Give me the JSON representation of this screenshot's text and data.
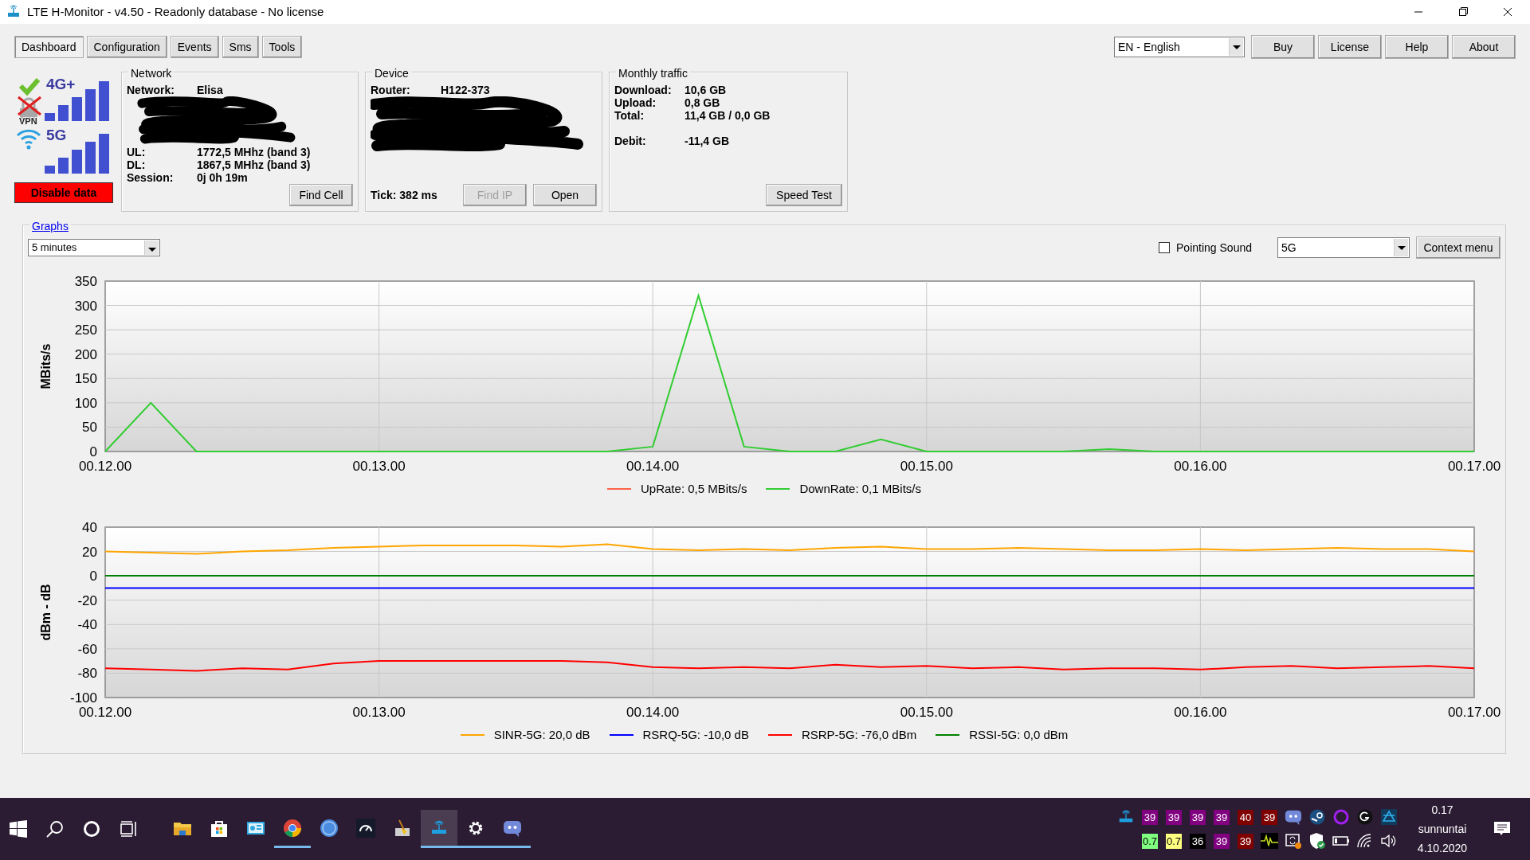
{
  "window": {
    "title": "LTE H-Monitor - v4.50 - Readonly database - No license"
  },
  "tabs": [
    {
      "label": "Dashboard",
      "selected": true
    },
    {
      "label": "Configuration",
      "selected": false
    },
    {
      "label": "Events",
      "selected": false
    },
    {
      "label": "Sms",
      "selected": false
    },
    {
      "label": "Tools",
      "selected": false
    }
  ],
  "language": {
    "value": "EN - English"
  },
  "top_buttons": [
    "Buy",
    "License",
    "Help",
    "About"
  ],
  "status": {
    "lte_label": "4G+",
    "nr_label": "5G",
    "vpn_label": "VPN",
    "disable_button": "Disable data"
  },
  "network": {
    "title": "Network",
    "rows_top": [
      {
        "label": "Network:",
        "value": "Elisa"
      }
    ],
    "rows_bottom": [
      {
        "label": "UL:",
        "value": "1772,5 MHhz (band 3)"
      },
      {
        "label": "DL:",
        "value": "1867,5 MHhz (band 3)"
      },
      {
        "label": "Session:",
        "value": "0j 0h 19m"
      }
    ],
    "button": "Find Cell"
  },
  "device": {
    "title": "Device",
    "rows_top": [
      {
        "label": "Router:",
        "value": "H122-373"
      }
    ],
    "tick": "Tick: 382 ms",
    "buttons": [
      {
        "label": "Find IP",
        "disabled": true
      },
      {
        "label": "Open",
        "disabled": false
      }
    ]
  },
  "traffic": {
    "title": "Monthly traffic",
    "rows": [
      {
        "label": "Download:",
        "value": "10,6 GB"
      },
      {
        "label": "Upload:",
        "value": "0,8 GB"
      },
      {
        "label": "Total:",
        "value": "11,4 GB / 0,0 GB"
      },
      {
        "label": "Debit:",
        "value": "-11,4 GB"
      }
    ],
    "button": "Speed Test"
  },
  "graphs": {
    "title": "Graphs",
    "period": "5 minutes",
    "pointing_sound": {
      "label": "Pointing Sound",
      "checked": false
    },
    "band": "5G",
    "context_button": "Context menu",
    "charts": [
      {
        "chart_data": {
          "type": "line",
          "grid": true,
          "ylabel": "MBits/s",
          "categories": [
            "00.12.00",
            null,
            null,
            null,
            null,
            null,
            "00.13.00",
            null,
            null,
            null,
            null,
            null,
            "00.14.00",
            null,
            null,
            null,
            null,
            null,
            "00.15.00",
            null,
            null,
            null,
            null,
            null,
            "00.16.00",
            null,
            null,
            null,
            null,
            null,
            "00.17.00"
          ],
          "ylim": [
            0,
            350
          ],
          "yticks": [
            0,
            50,
            100,
            150,
            200,
            250,
            300,
            350
          ],
          "series": [
            {
              "name": "UpRate: 0,5 MBits/s",
              "color": "#ff6347",
              "values": [
                null,
                null,
                null,
                null,
                null,
                null,
                null,
                null,
                null,
                null,
                null,
                null,
                null,
                null,
                null,
                null,
                null,
                null,
                null,
                null,
                null,
                null,
                null,
                null,
                null,
                null,
                null,
                null,
                null,
                null,
                null
              ]
            },
            {
              "name": "DownRate: 0,1 MBits/s",
              "color": "#32cd32",
              "values": [
                0,
                100,
                0,
                0,
                0,
                0,
                0,
                0,
                0,
                0,
                0,
                0,
                10,
                320,
                10,
                0,
                0,
                25,
                0,
                0,
                0,
                0,
                5,
                0,
                0,
                0,
                0,
                0,
                0,
                0,
                0
              ]
            }
          ]
        }
      },
      {
        "chart_data": {
          "type": "line",
          "grid": true,
          "ylabel": "dBm - dB",
          "categories": [
            "00.12.00",
            null,
            null,
            null,
            null,
            null,
            "00.13.00",
            null,
            null,
            null,
            null,
            null,
            "00.14.00",
            null,
            null,
            null,
            null,
            null,
            "00.15.00",
            null,
            null,
            null,
            null,
            null,
            "00.16.00",
            null,
            null,
            null,
            null,
            null,
            "00.17.00"
          ],
          "ylim": [
            -100,
            40
          ],
          "yticks": [
            -100,
            -80,
            -60,
            -40,
            -20,
            0,
            20,
            40
          ],
          "series": [
            {
              "name": "SINR-5G: 20,0 dB",
              "color": "#ffa500",
              "values": [
                20,
                19,
                18,
                20,
                21,
                23,
                24,
                25,
                25,
                25,
                24,
                26,
                22,
                21,
                22,
                21,
                23,
                24,
                22,
                22,
                23,
                22,
                21,
                21,
                22,
                21,
                22,
                23,
                22,
                22,
                20
              ]
            },
            {
              "name": "RSRQ-5G: -10,0 dB",
              "color": "#0000ff",
              "values": [
                -10,
                -10,
                -10,
                -10,
                -10,
                -10,
                -10,
                -10,
                -10,
                -10,
                -10,
                -10,
                -10,
                -10,
                -10,
                -10,
                -10,
                -10,
                -10,
                -10,
                -10,
                -10,
                -10,
                -10,
                -10,
                -10,
                -10,
                -10,
                -10,
                -10,
                -10
              ]
            },
            {
              "name": "RSRP-5G: -76,0 dBm",
              "color": "#ff0000",
              "values": [
                -76,
                -77,
                -78,
                -76,
                -77,
                -72,
                -70,
                -70,
                -70,
                -70,
                -70,
                -71,
                -75,
                -76,
                -75,
                -76,
                -73,
                -75,
                -74,
                -76,
                -75,
                -77,
                -76,
                -76,
                -77,
                -75,
                -74,
                -76,
                -75,
                -74,
                -76
              ]
            },
            {
              "name": "RSSI-5G: 0,0 dBm",
              "color": "#008000",
              "values": [
                0,
                0,
                0,
                0,
                0,
                0,
                0,
                0,
                0,
                0,
                0,
                0,
                0,
                0,
                0,
                0,
                0,
                0,
                0,
                0,
                0,
                0,
                0,
                0,
                0,
                0,
                0,
                0,
                0,
                0,
                0
              ]
            }
          ]
        }
      }
    ]
  },
  "taskbar": {
    "apps": [
      {
        "kind": "folder",
        "running": false,
        "selected": false
      },
      {
        "kind": "store",
        "running": false,
        "selected": false
      },
      {
        "kind": "dashboard",
        "running": false,
        "selected": false
      },
      {
        "kind": "browser",
        "running": true,
        "selected": false
      },
      {
        "kind": "torrent",
        "running": false,
        "selected": false
      },
      {
        "kind": "gauge",
        "running": false,
        "selected": false
      },
      {
        "kind": "cleaner",
        "running": false,
        "selected": false
      },
      {
        "kind": "router",
        "running": true,
        "selected": true
      },
      {
        "kind": "gear",
        "running": true,
        "selected": false
      },
      {
        "kind": "chat",
        "running": true,
        "selected": false
      }
    ],
    "tray_row1": [
      {
        "kind": "router"
      },
      {
        "kind": "badge",
        "text": "39",
        "color": "#800080"
      },
      {
        "kind": "badge",
        "text": "39",
        "color": "#800080"
      },
      {
        "kind": "badge",
        "text": "39",
        "color": "#800080"
      },
      {
        "kind": "badge",
        "text": "39",
        "color": "#800080"
      },
      {
        "kind": "badge",
        "text": "40",
        "color": "#800000"
      },
      {
        "kind": "badge",
        "text": "39",
        "color": "#800000"
      },
      {
        "kind": "chat"
      },
      {
        "kind": "steam"
      },
      {
        "kind": "ring"
      },
      {
        "kind": "logo"
      },
      {
        "kind": "app"
      }
    ],
    "tray_row2": [
      {
        "kind": "badge",
        "text": "0.7",
        "color": "#80ff80"
      },
      {
        "kind": "badge",
        "text": "0.7",
        "color": "#ffff80"
      },
      {
        "kind": "badge",
        "text": "36",
        "color": "#000000"
      },
      {
        "kind": "badge",
        "text": "39",
        "color": "#800080"
      },
      {
        "kind": "badge",
        "text": "39",
        "color": "#800000"
      },
      {
        "kind": "pulse"
      },
      {
        "kind": "sync"
      },
      {
        "kind": "shield"
      },
      {
        "kind": "battery"
      },
      {
        "kind": "wifi"
      },
      {
        "kind": "volume"
      }
    ],
    "clock": [
      "0.17",
      "sunnuntai",
      "4.10.2020"
    ]
  }
}
